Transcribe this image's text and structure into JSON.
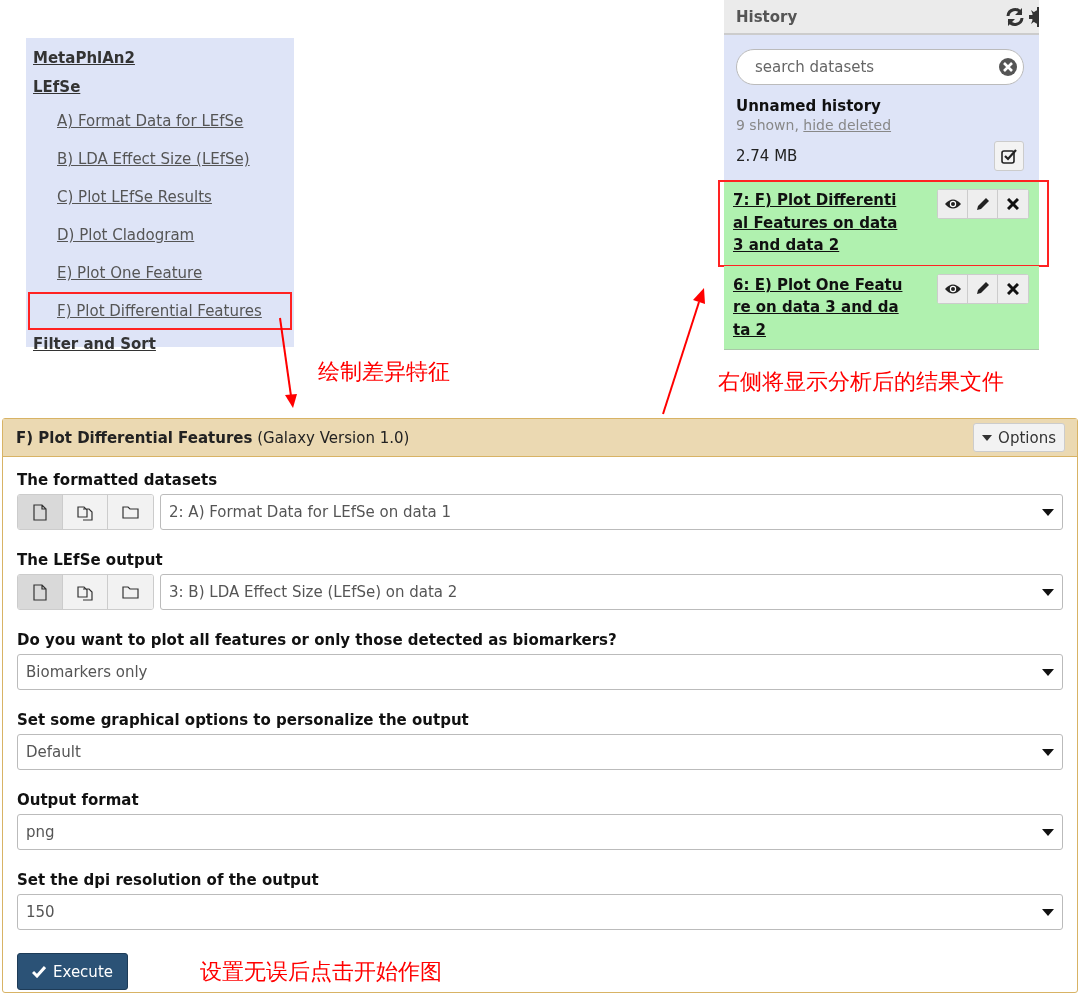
{
  "tool_panel": {
    "sections": [
      {
        "label": "MetaPhlAn2"
      },
      {
        "label": "LEfSe",
        "children": [
          {
            "label": "A) Format Data for LEfSe",
            "highlighted": false
          },
          {
            "label": "B) LDA Effect Size (LEfSe)",
            "highlighted": false
          },
          {
            "label": "C) Plot LEfSe Results",
            "highlighted": false
          },
          {
            "label": "D) Plot Cladogram",
            "highlighted": false
          },
          {
            "label": "E) Plot One Feature",
            "highlighted": false
          },
          {
            "label": "F) Plot Differential Features",
            "highlighted": true
          }
        ]
      },
      {
        "label": "Filter and Sort"
      }
    ]
  },
  "history": {
    "title": "History",
    "search": {
      "placeholder": "search datasets"
    },
    "name": "Unnamed history",
    "shown": "9 shown,",
    "hide_deleted": "hide deleted",
    "size": "2.74 MB",
    "datasets": [
      {
        "label": "7: F) Plot Differential Features on data 3 and data 2",
        "highlighted": true
      },
      {
        "label": "6: E) Plot One Feature on data 3 and data 2",
        "highlighted": false
      }
    ]
  },
  "annotations": [
    {
      "text": "绘制差异特征"
    },
    {
      "text": "右侧将显示分析后的结果文件"
    }
  ],
  "form": {
    "title": "F) Plot Differential Features",
    "version": "(Galaxy Version 1.0)",
    "options_button": "Options",
    "fields": [
      {
        "kind": "dataset",
        "label": "The formatted datasets",
        "value": "2: A) Format Data for LEfSe on data 1",
        "modes": [
          {
            "selected": true
          },
          {
            "selected": false
          },
          {
            "selected": false
          }
        ]
      },
      {
        "kind": "dataset",
        "label": "The LEfSe output",
        "value": "3: B) LDA Effect Size (LEfSe) on data 2",
        "modes": [
          {
            "selected": true
          },
          {
            "selected": false
          },
          {
            "selected": false
          }
        ]
      },
      {
        "kind": "select",
        "label": "Do you want to plot all features or only those detected as biomarkers?",
        "value": "Biomarkers only"
      },
      {
        "kind": "select",
        "label": "Set some graphical options to personalize the output",
        "value": "Default"
      },
      {
        "kind": "select",
        "label": "Output format",
        "value": "png"
      },
      {
        "kind": "select",
        "label": "Set the dpi resolution of the output",
        "value": "150"
      }
    ],
    "execute_button": "Execute",
    "note": "设置无误后点击开始作图"
  }
}
